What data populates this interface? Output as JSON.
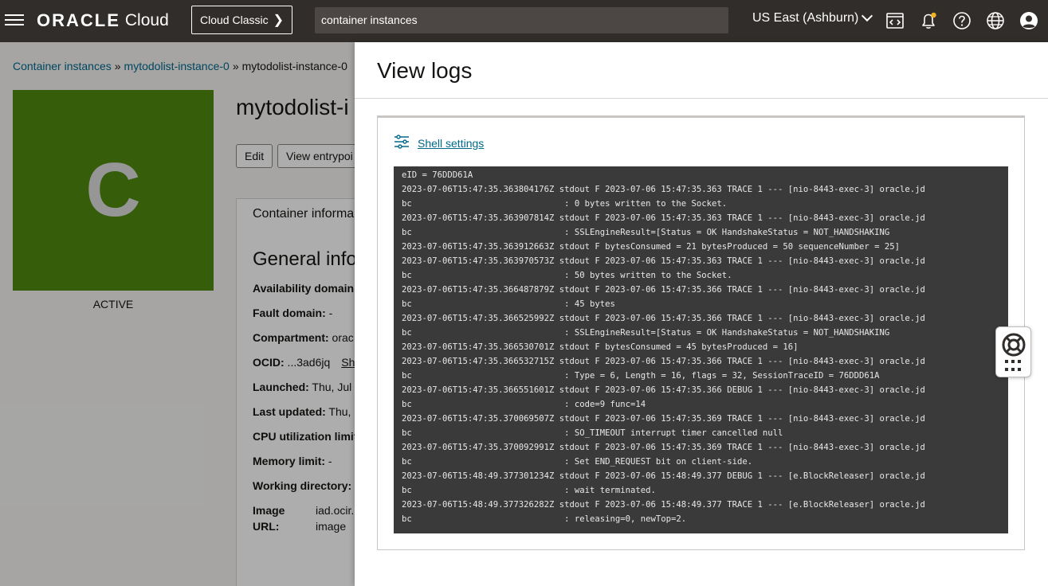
{
  "header": {
    "brand": "ORACLE",
    "brand_suffix": "Cloud",
    "classic_button": "Cloud Classic",
    "search_value": "container instances",
    "region": "US East (Ashburn)"
  },
  "breadcrumb": {
    "items": [
      "Container instances",
      "mytodolist-instance-0"
    ],
    "current": "mytodolist-instance-0"
  },
  "instance": {
    "tile_letter": "C",
    "status": "ACTIVE",
    "title": "mytodolist-i",
    "buttons": [
      "Edit",
      "View entrypoi"
    ],
    "card_tab": "Container informa",
    "section_title": "General info",
    "rows": [
      {
        "label": "Availability domain:",
        "value": ""
      },
      {
        "label": "Fault domain:",
        "value": " -"
      },
      {
        "label": "Compartment:",
        "value": " orac"
      },
      {
        "label": "OCID:",
        "value": " ...3ad6jq",
        "link": "Sh"
      },
      {
        "label": "Launched:",
        "value": " Thu, Jul"
      },
      {
        "label": "Last updated:",
        "value": " Thu,"
      },
      {
        "label": "CPU utilization limit",
        "value": ""
      },
      {
        "label": "Memory limit:",
        "value": " -"
      },
      {
        "label": "Working directory:",
        "value": ""
      }
    ],
    "image_label_1": "Image",
    "image_label_2": "URL:",
    "image_value_1": "iad.ocir.",
    "image_value_2": "image"
  },
  "drawer": {
    "title": "View logs",
    "shell_settings": "Shell settings",
    "log_lines": [
      "eID = 76DDD61A",
      "2023-07-06T15:47:35.363804176Z stdout F 2023-07-06 15:47:35.363 TRACE 1 --- [nio-8443-exec-3] oracle.jd",
      "bc                              : 0 bytes written to the Socket.",
      "2023-07-06T15:47:35.363907814Z stdout F 2023-07-06 15:47:35.363 TRACE 1 --- [nio-8443-exec-3] oracle.jd",
      "bc                              : SSLEngineResult=[Status = OK HandshakeStatus = NOT_HANDSHAKING",
      "2023-07-06T15:47:35.363912663Z stdout F bytesConsumed = 21 bytesProduced = 50 sequenceNumber = 25]",
      "2023-07-06T15:47:35.363970573Z stdout F 2023-07-06 15:47:35.363 TRACE 1 --- [nio-8443-exec-3] oracle.jd",
      "bc                              : 50 bytes written to the Socket.",
      "2023-07-06T15:47:35.366487879Z stdout F 2023-07-06 15:47:35.366 TRACE 1 --- [nio-8443-exec-3] oracle.jd",
      "bc                              : 45 bytes",
      "2023-07-06T15:47:35.366525992Z stdout F 2023-07-06 15:47:35.366 TRACE 1 --- [nio-8443-exec-3] oracle.jd",
      "bc                              : SSLEngineResult=[Status = OK HandshakeStatus = NOT_HANDSHAKING",
      "2023-07-06T15:47:35.366530701Z stdout F bytesConsumed = 45 bytesProduced = 16]",
      "2023-07-06T15:47:35.366532715Z stdout F 2023-07-06 15:47:35.366 TRACE 1 --- [nio-8443-exec-3] oracle.jd",
      "bc                              : Type = 6, Length = 16, flags = 32, SessionTraceID = 76DDD61A",
      "2023-07-06T15:47:35.366551601Z stdout F 2023-07-06 15:47:35.366 DEBUG 1 --- [nio-8443-exec-3] oracle.jd",
      "bc                              : code=9 func=14",
      "2023-07-06T15:47:35.370069507Z stdout F 2023-07-06 15:47:35.369 TRACE 1 --- [nio-8443-exec-3] oracle.jd",
      "bc                              : SO_TIMEOUT interrupt timer cancelled null",
      "2023-07-06T15:47:35.370092991Z stdout F 2023-07-06 15:47:35.369 TRACE 1 --- [nio-8443-exec-3] oracle.jd",
      "bc                              : Set END_REQUEST bit on client-side.",
      "2023-07-06T15:48:49.377301234Z stdout F 2023-07-06 15:48:49.377 DEBUG 1 --- [e.BlockReleaser] oracle.jd",
      "bc                              : wait terminated.",
      "2023-07-06T15:48:49.377326282Z stdout F 2023-07-06 15:48:49.377 TRACE 1 --- [e.BlockReleaser] oracle.jd",
      "bc                              : releasing=0, newTop=2."
    ]
  },
  "icons": {
    "menu": "hamburger-menu-icon",
    "code_editor": "code-editor-icon",
    "notifications": "bell-icon",
    "help": "help-icon",
    "language": "globe-icon",
    "profile": "user-profile-icon",
    "shell_settings": "sliders-icon",
    "support": "lifebuoy-icon",
    "apps": "apps-grid-icon"
  },
  "colors": {
    "header_bg": "#312d2a",
    "tile_bg": "#4f8a10",
    "link": "#00688c",
    "terminal_bg": "#3a3a3a",
    "notification_dot": "#f0b323"
  }
}
